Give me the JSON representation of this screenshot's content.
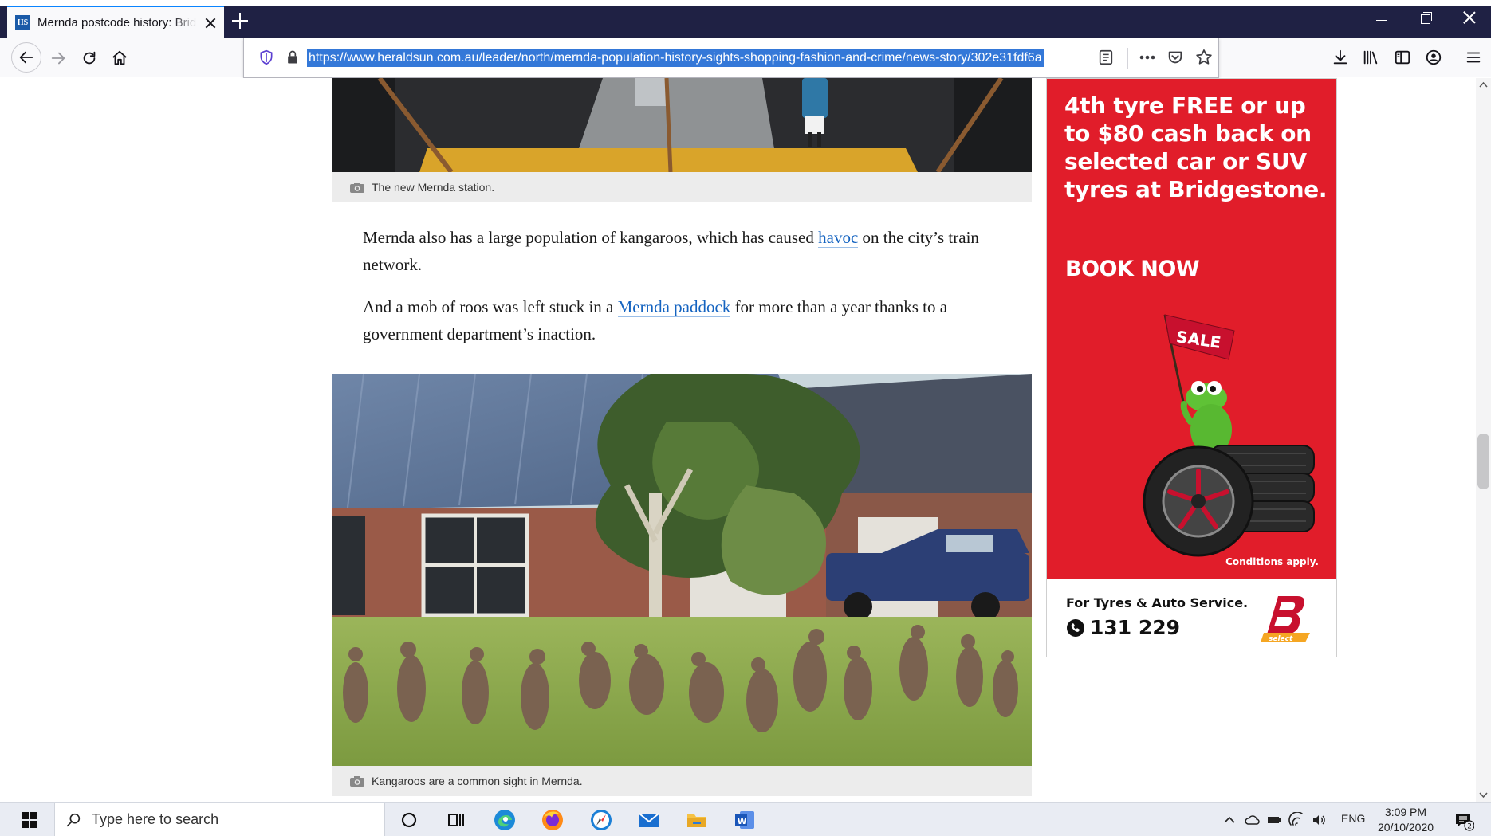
{
  "browser": {
    "tab": {
      "favicon_text": "HS",
      "title": "Mernda postcode history: Bridgewater shopping"
    },
    "url": "https://www.heraldsun.com.au/leader/north/mernda-population-history-sights-shopping-fashion-and-crime/news-story/302e31fdf6a"
  },
  "article": {
    "caption_top": "The new Mernda station.",
    "para1": {
      "before": "Mernda also has a large population of kangaroos, which has caused ",
      "link": "havoc",
      "after": " on the city’s train network."
    },
    "para2": {
      "before": "And a mob of roos was left stuck in a ",
      "link": "Mernda paddock",
      "after": " for more than a year thanks to a government department’s inaction."
    },
    "caption_main": "Kangaroos are a common sight in Mernda."
  },
  "ad": {
    "headline": "4th tyre FREE or up to $80 cash back on selected car or SUV tyres at Bridgestone.",
    "cta": "BOOK NOW",
    "flag_text": "SALE",
    "conditions": "Conditions apply.",
    "footer_label": "For Tyres & Auto Service.",
    "phone": "131 229",
    "logo_sub": "select",
    "colors": {
      "background": "#e11d2a"
    }
  },
  "taskbar": {
    "search_placeholder": "Type here to search",
    "language": "ENG",
    "time": "3:09 PM",
    "date": "20/10/2020",
    "notification_count": "2",
    "apps": [
      "cortana-icon",
      "task-view-icon",
      "edge-icon",
      "firefox-icon",
      "safari-icon",
      "mail-icon",
      "file-explorer-icon",
      "word-icon"
    ]
  }
}
